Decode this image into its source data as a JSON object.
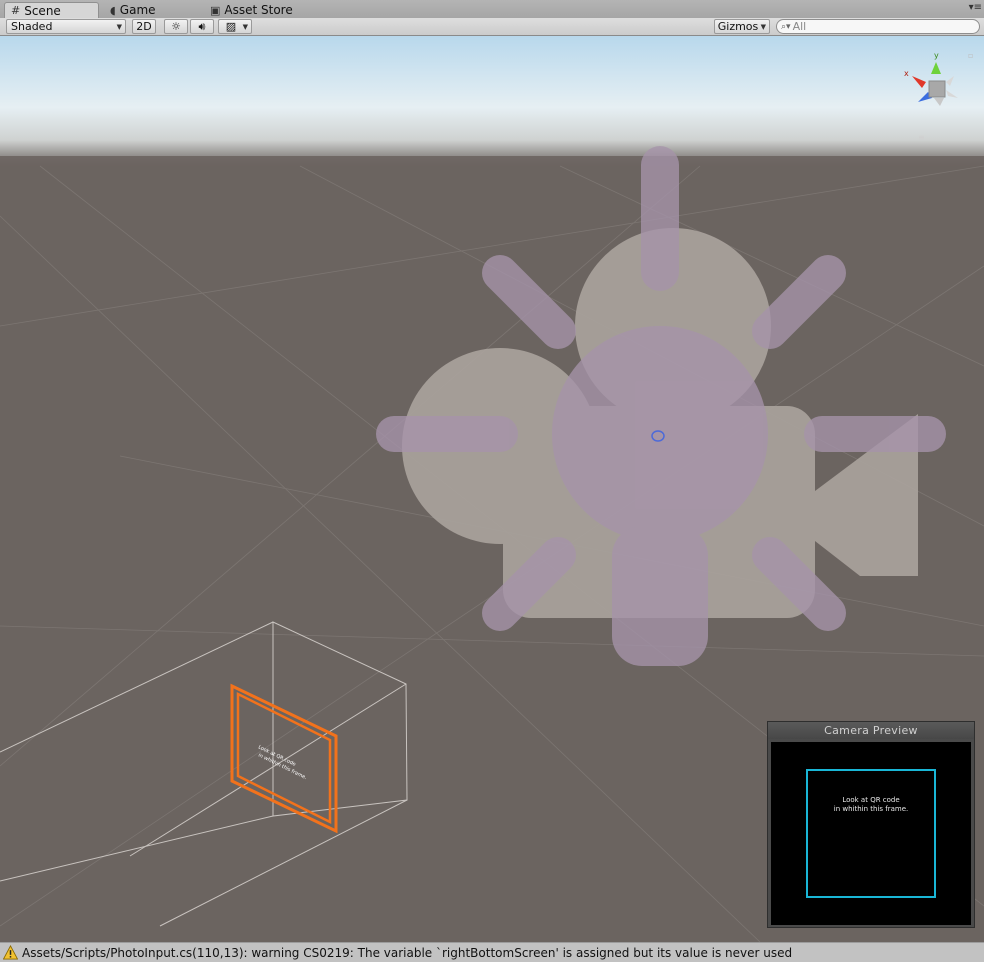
{
  "tabs": [
    {
      "label": "Scene",
      "icon": "grid-icon",
      "active": true
    },
    {
      "label": "Game",
      "icon": "pacman-icon",
      "active": false
    },
    {
      "label": "Asset Store",
      "icon": "store-icon",
      "active": false
    }
  ],
  "toolbar": {
    "shading_mode": "Shaded",
    "mode_2d_label": "2D",
    "gizmos_label": "Gizmos",
    "search_placeholder": "All"
  },
  "scene": {
    "frame_text_1": "Look at QR code",
    "frame_text_2": "in whithin this frame.",
    "axis_y_label": "y",
    "axis_x_label": "x",
    "axis_colors": {
      "x": "#e0382a",
      "y": "#6ed23a",
      "z": "#3b6ee0"
    },
    "selection_color": "#f2721c"
  },
  "camera_preview": {
    "title": "Camera Preview",
    "frame_text": "Look at QR code\nin whithin this frame.",
    "frame_color": "#19b6d6"
  },
  "status": {
    "icon": "warning-icon",
    "message": "Assets/Scripts/PhotoInput.cs(110,13): warning CS0219: The variable `rightBottomScreen' is assigned but its value is never used"
  }
}
